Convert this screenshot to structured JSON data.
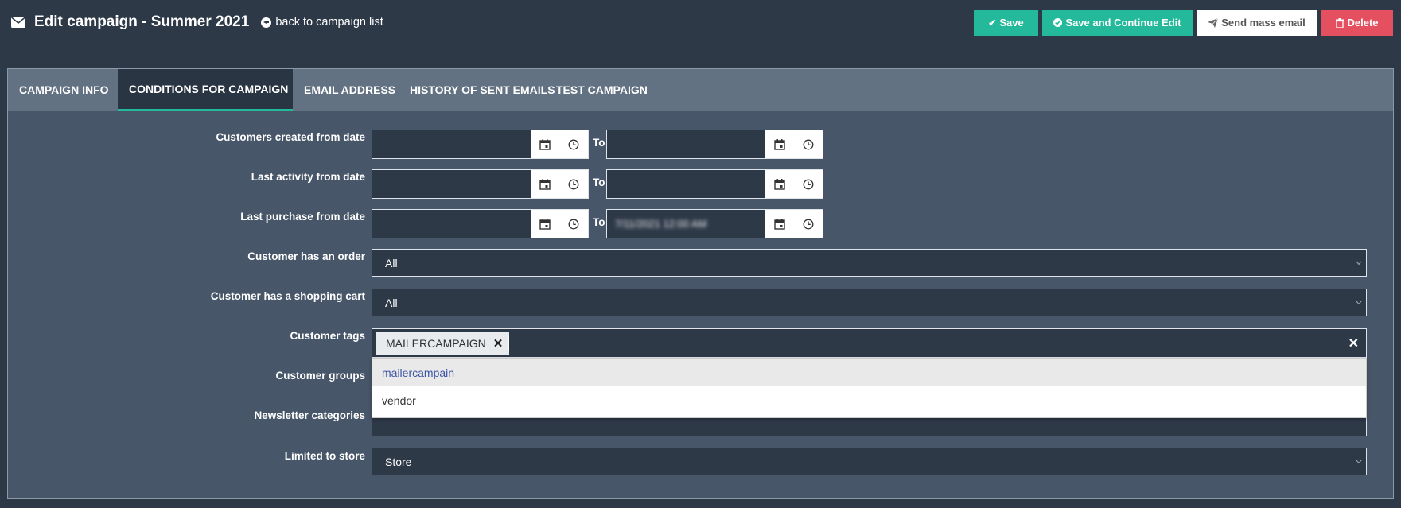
{
  "header": {
    "title": "Edit campaign - Summer 2021",
    "back_label": "back to campaign list"
  },
  "toolbar": {
    "save_label": "Save",
    "save_continue_label": "Save and Continue Edit",
    "send_mass_email_label": "Send mass email",
    "delete_label": "Delete"
  },
  "colors": {
    "accent": "#23b99a",
    "danger": "#e4505f",
    "background": "#2e3948",
    "panel": "#475668",
    "tabbar": "#637282"
  },
  "tabs": [
    {
      "label": "CAMPAIGN INFO",
      "active": false
    },
    {
      "label": "CONDITIONS FOR CAMPAIGN",
      "active": true
    },
    {
      "label": "EMAIL ADDRESS",
      "active": false
    },
    {
      "label": "HISTORY OF SENT EMAILS",
      "active": false
    },
    {
      "label": "TEST CAMPAIGN",
      "active": false
    }
  ],
  "form": {
    "to_label": "To",
    "date_rows": [
      {
        "label": "Customers created from date",
        "from_value": "",
        "to_value": ""
      },
      {
        "label": "Last activity from date",
        "from_value": "",
        "to_value": ""
      },
      {
        "label": "Last purchase from date",
        "from_value": "",
        "to_value": "7/11/2021 12:00 AM"
      }
    ],
    "has_order": {
      "label": "Customer has an order",
      "value": "All"
    },
    "has_cart": {
      "label": "Customer has a shopping cart",
      "value": "All"
    },
    "tags": {
      "label": "Customer tags",
      "selected": [
        "MAILERCAMPAIGN"
      ],
      "options": [
        "mailercampain",
        "vendor"
      ]
    },
    "groups": {
      "label": "Customer groups"
    },
    "newsletter": {
      "label": "Newsletter categories"
    },
    "store": {
      "label": "Limited to store",
      "value": "Store"
    }
  },
  "icons": {
    "title": "envelope-icon",
    "back": "arrow-circle-left-icon",
    "save": "check-icon",
    "save_continue": "check-circle-icon",
    "send": "paper-plane-icon",
    "delete": "trash-icon",
    "calendar": "calendar-icon",
    "clock": "clock-icon"
  }
}
